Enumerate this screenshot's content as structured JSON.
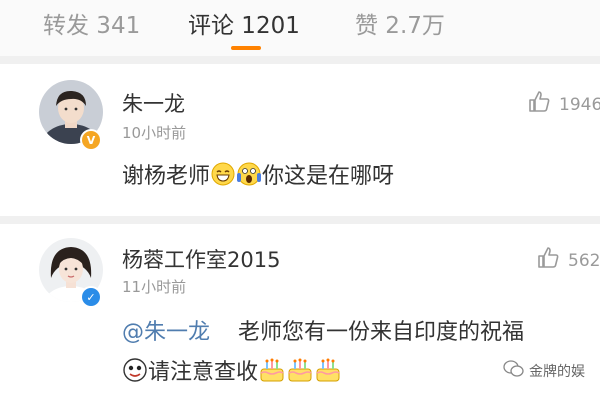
{
  "tabs": {
    "repost": "转发 341",
    "comments": "评论 1201",
    "likes": "赞 2.7万"
  },
  "colors": {
    "accent": "#ff8200",
    "mention": "#507daf",
    "verified_yellow": "#f5a623",
    "verified_blue": "#2a8ce8"
  },
  "comments": [
    {
      "username": "朱一龙",
      "time": "10小时前",
      "likes": "1946",
      "verified": "yellow",
      "text_a": "谢杨老师",
      "emojis": [
        "grin-emoji",
        "scream-emoji"
      ],
      "text_b": "你这是在哪呀"
    },
    {
      "username": "杨蓉工作室2015",
      "time": "11小时前",
      "likes": "562",
      "verified": "blue",
      "mention": "@朱一龙",
      "line1": "老师您有一份来自印度的祝福",
      "line2": "请注意查收",
      "emojis": [
        "face-emoji",
        "cake-emoji",
        "cake-emoji",
        "cake-emoji"
      ]
    }
  ],
  "watermark": {
    "text": "金牌的娱"
  },
  "icons": [
    "thumbs-up-icon",
    "verified-icon",
    "wechat-icon"
  ]
}
